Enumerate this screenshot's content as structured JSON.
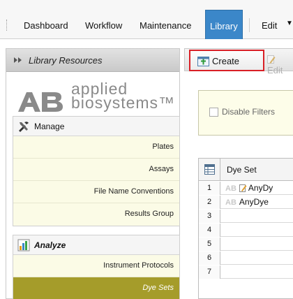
{
  "menu": {
    "items": [
      {
        "label": "Dashboard",
        "active": false
      },
      {
        "label": "Workflow",
        "active": false
      },
      {
        "label": "Maintenance",
        "active": false
      },
      {
        "label": "Library",
        "active": true
      },
      {
        "label": "Edit",
        "active": false
      }
    ]
  },
  "left_panel": {
    "title": "Library Resources",
    "logo": {
      "line1": "applied",
      "line2": "biosystems™",
      "mark": "AB"
    },
    "sections": [
      {
        "label": "Manage",
        "items": [
          "Plates",
          "Assays",
          "File Name Conventions",
          "Results Group"
        ]
      },
      {
        "label": "Analyze",
        "items": [
          "Instrument Protocols",
          "Dye Sets"
        ]
      }
    ],
    "selected_item": "Dye Sets"
  },
  "toolbar": {
    "create_label": "Create",
    "edit_label": "Edit"
  },
  "filters": {
    "disable_filters_label": "Disable Filters",
    "checked": false
  },
  "grid": {
    "column_header": "Dye Set",
    "rows": [
      {
        "num": "1",
        "value": "AnyDy",
        "badge": "AB",
        "editable": true
      },
      {
        "num": "2",
        "value": "AnyDye",
        "badge": "AB",
        "editable": false
      },
      {
        "num": "3",
        "value": ""
      },
      {
        "num": "4",
        "value": ""
      },
      {
        "num": "5",
        "value": ""
      },
      {
        "num": "6",
        "value": ""
      },
      {
        "num": "7",
        "value": ""
      }
    ]
  },
  "colors": {
    "accent": "#3b87c9",
    "highlight": "#d91f26",
    "selected_nav": "#a59c2a"
  }
}
